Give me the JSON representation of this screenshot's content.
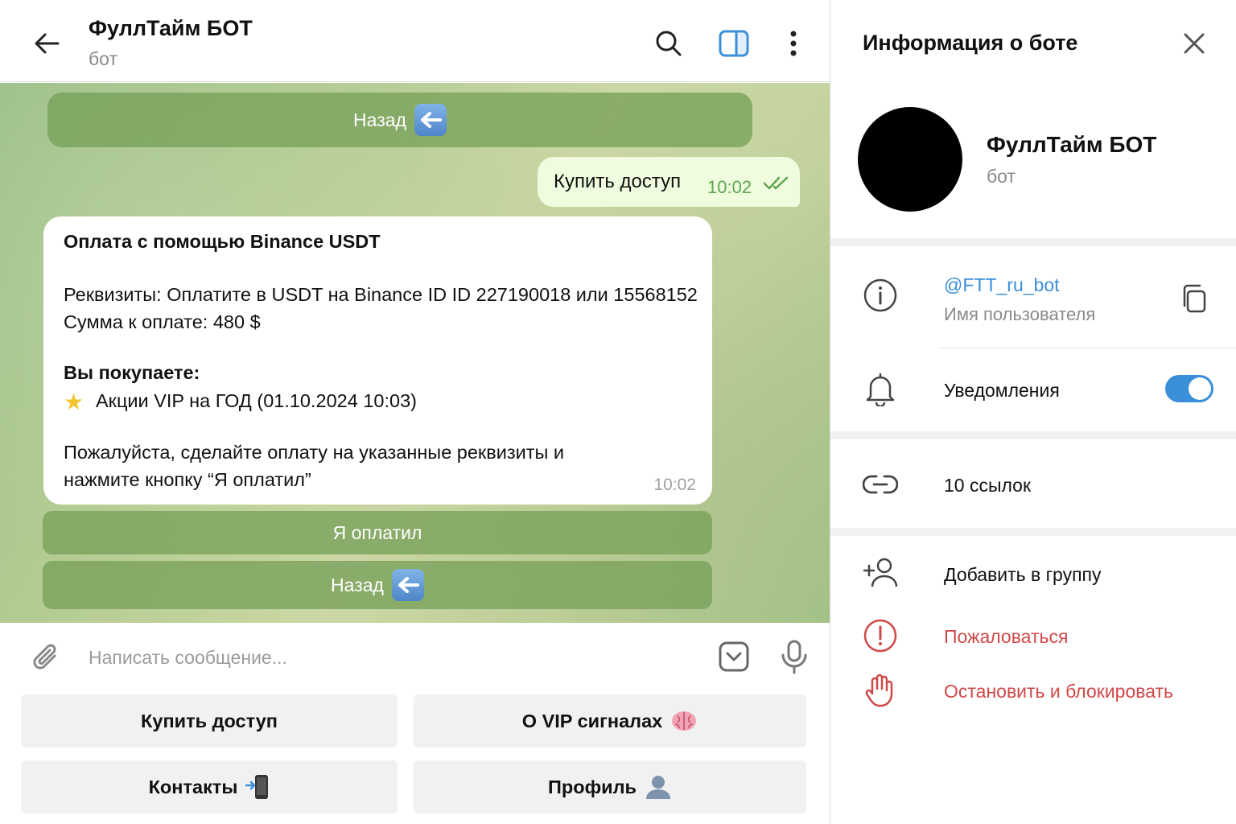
{
  "chat": {
    "title": "ФуллТайм БОТ",
    "subtitle": "бот"
  },
  "messages": {
    "top_button": "Назад",
    "outgoing": {
      "text": "Купить доступ",
      "time": "10:02"
    },
    "incoming": {
      "heading": "Оплата с помощью Binance USDT",
      "line1": "Реквизиты: Оплатите в USDT на Binance ID ID 227190018 или 15568152",
      "line2": "Сумма к оплате: 480 $",
      "buying_label": "Вы покупаете:",
      "product": "Акции VIP на ГОД  (01.10.2024 10:03)",
      "note1": "Пожалуйста, сделайте оплату на указанные реквизиты и",
      "note2": "нажмите кнопку “Я оплатил”",
      "time": "10:02"
    },
    "inline_buttons": [
      "Я оплатил",
      "Назад"
    ]
  },
  "input": {
    "placeholder": "Написать сообщение..."
  },
  "reply_keyboard": [
    "Купить доступ",
    "О VIP сигналах",
    "Контакты",
    "Профиль"
  ],
  "info": {
    "title": "Информация о боте",
    "name": "ФуллТайм БОТ",
    "subtitle": "бот",
    "username": "@FTT_ru_bot",
    "username_label": "Имя пользователя",
    "notifications": "Уведомления",
    "links": "10 ссылок",
    "add_to_group": "Добавить в группу",
    "report": "Пожаловаться",
    "block": "Остановить и блокировать"
  },
  "colors": {
    "accent": "#3a8fd8",
    "danger": "#d04848",
    "check": "#5fa44f"
  },
  "state": {
    "notifications_enabled": true
  }
}
